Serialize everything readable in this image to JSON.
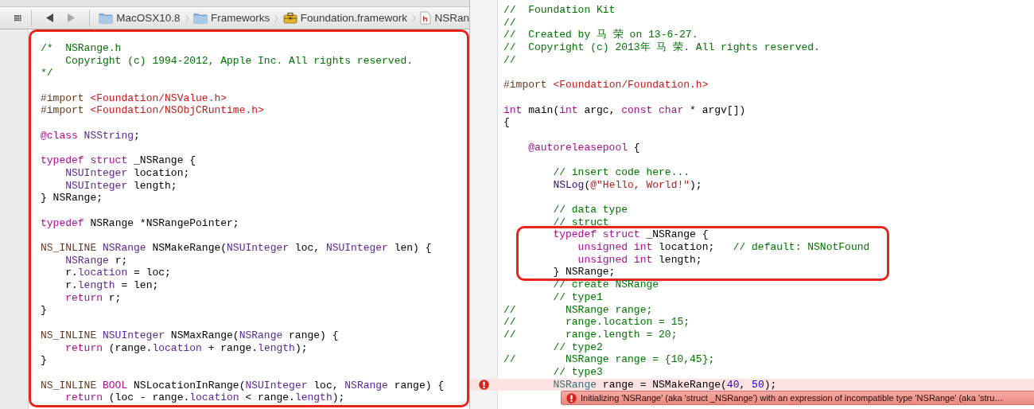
{
  "breadcrumb": {
    "back": {
      "disabled": false
    },
    "forward": {
      "disabled": true
    },
    "items": [
      {
        "kind": "folder",
        "label": "MacOSX10.8"
      },
      {
        "kind": "folder",
        "label": "Frameworks"
      },
      {
        "kind": "framework",
        "label": "Foundation.framework"
      },
      {
        "kind": "header",
        "label": "NSRan"
      }
    ]
  },
  "left_editor": {
    "blocks": [
      {
        "kind": "highlight",
        "lines": [
          {
            "kind": "code",
            "tokens": [
              {
                "kind": "comment",
                "text": "/*  NSRange.h"
              }
            ]
          },
          {
            "kind": "code",
            "tokens": [
              {
                "kind": "comment",
                "text": "    Copyright (c) 1994-2012, Apple Inc. All rights reserved."
              }
            ]
          },
          {
            "kind": "code",
            "tokens": [
              {
                "kind": "comment",
                "text": "*/"
              }
            ]
          },
          {
            "kind": "blank"
          },
          {
            "kind": "code",
            "tokens": [
              {
                "kind": "preproc",
                "text": "#import "
              },
              {
                "kind": "string",
                "text": "<Foundation/NSValue.h>"
              }
            ]
          },
          {
            "kind": "code",
            "tokens": [
              {
                "kind": "preproc",
                "text": "#import "
              },
              {
                "kind": "string",
                "text": "<Foundation/NSObjCRuntime.h>"
              }
            ]
          },
          {
            "kind": "blank"
          },
          {
            "kind": "code",
            "tokens": [
              {
                "kind": "keyword",
                "text": "@class "
              },
              {
                "kind": "type",
                "text": "NSString"
              },
              {
                "kind": "plain",
                "text": ";"
              }
            ]
          },
          {
            "kind": "blank"
          },
          {
            "kind": "code",
            "tokens": [
              {
                "kind": "keyword",
                "text": "typedef struct "
              },
              {
                "kind": "plain",
                "text": "_NSRange {"
              }
            ]
          },
          {
            "kind": "code",
            "tokens": [
              {
                "kind": "type",
                "text": "    NSUInteger"
              },
              {
                "kind": "plain",
                "text": " location;"
              }
            ]
          },
          {
            "kind": "code",
            "tokens": [
              {
                "kind": "type",
                "text": "    NSUInteger"
              },
              {
                "kind": "plain",
                "text": " length;"
              }
            ]
          },
          {
            "kind": "code",
            "tokens": [
              {
                "kind": "plain",
                "text": "} NSRange;"
              }
            ]
          },
          {
            "kind": "blank"
          },
          {
            "kind": "code",
            "tokens": [
              {
                "kind": "keyword",
                "text": "typedef "
              },
              {
                "kind": "plain",
                "text": "NSRange *NSRangePointer;"
              }
            ]
          },
          {
            "kind": "blank"
          },
          {
            "kind": "code",
            "tokens": [
              {
                "kind": "preproc",
                "text": "NS_INLINE "
              },
              {
                "kind": "type",
                "text": "NSRange"
              },
              {
                "kind": "plain",
                "text": " NSMakeRange("
              },
              {
                "kind": "type",
                "text": "NSUInteger"
              },
              {
                "kind": "plain",
                "text": " loc, "
              },
              {
                "kind": "type",
                "text": "NSUInteger"
              },
              {
                "kind": "plain",
                "text": " len) {"
              }
            ]
          },
          {
            "kind": "code",
            "tokens": [
              {
                "kind": "type",
                "text": "    NSRange"
              },
              {
                "kind": "plain",
                "text": " r;"
              }
            ]
          },
          {
            "kind": "code",
            "tokens": [
              {
                "kind": "plain",
                "text": "    r."
              },
              {
                "kind": "type",
                "text": "location"
              },
              {
                "kind": "plain",
                "text": " = loc;"
              }
            ]
          },
          {
            "kind": "code",
            "tokens": [
              {
                "kind": "plain",
                "text": "    r."
              },
              {
                "kind": "type",
                "text": "length"
              },
              {
                "kind": "plain",
                "text": " = len;"
              }
            ]
          },
          {
            "kind": "code",
            "tokens": [
              {
                "kind": "keyword",
                "text": "    return"
              },
              {
                "kind": "plain",
                "text": " r;"
              }
            ]
          },
          {
            "kind": "code",
            "tokens": [
              {
                "kind": "plain",
                "text": "}"
              }
            ]
          },
          {
            "kind": "blank"
          },
          {
            "kind": "code",
            "tokens": [
              {
                "kind": "preproc",
                "text": "NS_INLINE "
              },
              {
                "kind": "type",
                "text": "NSUInteger"
              },
              {
                "kind": "plain",
                "text": " NSMaxRange("
              },
              {
                "kind": "type",
                "text": "NSRange"
              },
              {
                "kind": "plain",
                "text": " range) {"
              }
            ]
          },
          {
            "kind": "code",
            "tokens": [
              {
                "kind": "keyword",
                "text": "    return"
              },
              {
                "kind": "plain",
                "text": " (range."
              },
              {
                "kind": "type",
                "text": "location"
              },
              {
                "kind": "plain",
                "text": " + range."
              },
              {
                "kind": "type",
                "text": "length"
              },
              {
                "kind": "plain",
                "text": ");"
              }
            ]
          },
          {
            "kind": "code",
            "tokens": [
              {
                "kind": "plain",
                "text": "}"
              }
            ]
          },
          {
            "kind": "blank"
          },
          {
            "kind": "code",
            "tokens": [
              {
                "kind": "preproc",
                "text": "NS_INLINE "
              },
              {
                "kind": "keyword",
                "text": "BOOL"
              },
              {
                "kind": "plain",
                "text": " NSLocationInRange("
              },
              {
                "kind": "type",
                "text": "NSUInteger"
              },
              {
                "kind": "plain",
                "text": " loc, "
              },
              {
                "kind": "type",
                "text": "NSRange"
              },
              {
                "kind": "plain",
                "text": " range) {"
              }
            ]
          },
          {
            "kind": "code",
            "tokens": [
              {
                "kind": "keyword",
                "text": "    return"
              },
              {
                "kind": "plain",
                "text": " (loc - range."
              },
              {
                "kind": "type",
                "text": "location"
              },
              {
                "kind": "plain",
                "text": " < range."
              },
              {
                "kind": "type",
                "text": "length"
              },
              {
                "kind": "plain",
                "text": ");"
              }
            ]
          }
        ]
      }
    ]
  },
  "right_editor": {
    "blocks": [
      {
        "kind": "plain",
        "lines": [
          {
            "kind": "code",
            "tokens": [
              {
                "kind": "comment",
                "text": "//  Foundation Kit"
              }
            ]
          },
          {
            "kind": "code",
            "tokens": [
              {
                "kind": "comment",
                "text": "//"
              }
            ]
          },
          {
            "kind": "code",
            "tokens": [
              {
                "kind": "comment",
                "text": "//  Created by 马 荣 on 13-6-27."
              }
            ]
          },
          {
            "kind": "code",
            "tokens": [
              {
                "kind": "comment",
                "text": "//  Copyright (c) 2013年 马 荣. All rights reserved."
              }
            ]
          },
          {
            "kind": "code",
            "tokens": [
              {
                "kind": "comment",
                "text": "//"
              }
            ]
          },
          {
            "kind": "blank"
          },
          {
            "kind": "code",
            "tokens": [
              {
                "kind": "preproc",
                "text": "#import "
              },
              {
                "kind": "string",
                "text": "<Foundation/Foundation.h>"
              }
            ]
          },
          {
            "kind": "blank"
          },
          {
            "kind": "code",
            "tokens": [
              {
                "kind": "keyword",
                "text": "int"
              },
              {
                "kind": "plain",
                "text": " main("
              },
              {
                "kind": "keyword",
                "text": "int"
              },
              {
                "kind": "plain",
                "text": " argc, "
              },
              {
                "kind": "keyword",
                "text": "const char"
              },
              {
                "kind": "plain",
                "text": " * argv[])"
              }
            ]
          },
          {
            "kind": "code",
            "tokens": [
              {
                "kind": "plain",
                "text": "{"
              }
            ]
          },
          {
            "kind": "blank"
          },
          {
            "kind": "code",
            "tokens": [
              {
                "kind": "keyword",
                "text": "    @autoreleasepool"
              },
              {
                "kind": "plain",
                "text": " {"
              }
            ]
          },
          {
            "kind": "blank"
          },
          {
            "kind": "code",
            "tokens": [
              {
                "kind": "comment",
                "text": "        // insert code here..."
              }
            ]
          },
          {
            "kind": "code",
            "tokens": [
              {
                "kind": "func",
                "text": "        NSLog"
              },
              {
                "kind": "plain",
                "text": "("
              },
              {
                "kind": "string",
                "text": "@\"Hello, World!\""
              },
              {
                "kind": "plain",
                "text": ");"
              }
            ]
          },
          {
            "kind": "blank"
          },
          {
            "kind": "code",
            "tokens": [
              {
                "kind": "comment",
                "text": "        // data type"
              }
            ]
          },
          {
            "kind": "code",
            "tokens": [
              {
                "kind": "comment",
                "text": "        // struct"
              }
            ]
          }
        ]
      },
      {
        "kind": "highlight",
        "lines": [
          {
            "kind": "code",
            "tokens": [
              {
                "kind": "keyword",
                "text": "        typedef struct"
              },
              {
                "kind": "plain",
                "text": " _NSRange {"
              }
            ]
          },
          {
            "kind": "code",
            "tokens": [
              {
                "kind": "keyword",
                "text": "            unsigned int"
              },
              {
                "kind": "plain",
                "text": " location;   "
              },
              {
                "kind": "comment",
                "text": "// default: NSNotFound"
              }
            ]
          },
          {
            "kind": "code",
            "tokens": [
              {
                "kind": "keyword",
                "text": "            unsigned int"
              },
              {
                "kind": "plain",
                "text": " length;"
              }
            ]
          },
          {
            "kind": "code",
            "tokens": [
              {
                "kind": "plain",
                "text": "        } NSRange;"
              }
            ]
          }
        ]
      },
      {
        "kind": "plain",
        "lines": [
          {
            "kind": "code",
            "tokens": [
              {
                "kind": "comment",
                "text": "        // create NSRange"
              }
            ]
          },
          {
            "kind": "code",
            "tokens": [
              {
                "kind": "comment",
                "text": "        // type1"
              }
            ]
          },
          {
            "kind": "code",
            "tokens": [
              {
                "kind": "comment",
                "text": "//        NSRange range;"
              }
            ]
          },
          {
            "kind": "code",
            "tokens": [
              {
                "kind": "comment",
                "text": "//        range.location = 15;"
              }
            ]
          },
          {
            "kind": "code",
            "tokens": [
              {
                "kind": "comment",
                "text": "//        range.length = 20;"
              }
            ]
          },
          {
            "kind": "code",
            "tokens": [
              {
                "kind": "comment",
                "text": "        // type2"
              }
            ]
          },
          {
            "kind": "code",
            "tokens": [
              {
                "kind": "comment",
                "text": "//        NSRange range = {10,45};"
              }
            ]
          },
          {
            "kind": "code",
            "tokens": [
              {
                "kind": "comment",
                "text": "        // type3"
              }
            ]
          }
        ]
      },
      {
        "kind": "error",
        "lines": [
          {
            "kind": "code",
            "tokens": [
              {
                "kind": "var",
                "text": "        NSRange"
              },
              {
                "kind": "plain",
                "text": " range = NSMakeRange("
              },
              {
                "kind": "number",
                "text": "40"
              },
              {
                "kind": "plain",
                "text": ", "
              },
              {
                "kind": "number",
                "text": "50"
              },
              {
                "kind": "plain",
                "text": ");"
              }
            ]
          }
        ],
        "message": "Initializing 'NSRange' (aka 'struct _NSRange') with an expression of incompatible type 'NSRange' (aka 'stru…"
      }
    ]
  }
}
